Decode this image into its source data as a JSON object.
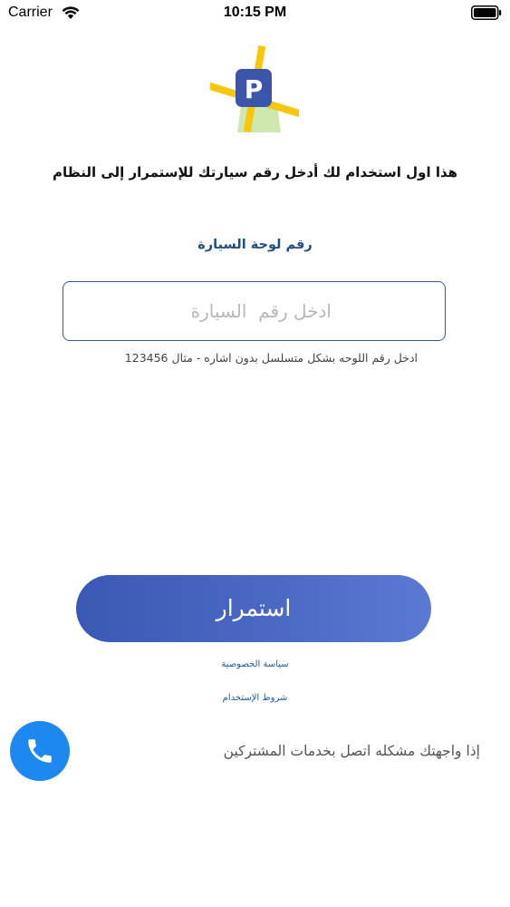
{
  "status_bar": {
    "carrier": "Carrier",
    "time": "10:15 PM"
  },
  "logo": {
    "letter": "P"
  },
  "headline": "هذا اول استخدام لك أدخل رقم سيارتك للإستمرار إلى النظام",
  "plate": {
    "label": "رقم لوحة السيارة",
    "placeholder": "ادخل رقم  السيارة",
    "hint": "ادخل رقم اللوحه بشكل متسلسل بدون اشاره -  مثال 123456"
  },
  "continue_label": "استمرار",
  "links": {
    "privacy": "سياسة الخصوصية",
    "terms": "شروط الإستخدام"
  },
  "support_text": "إذا واجهتك مشكله اتصل بخدمات المشتركين",
  "colors": {
    "accent": "#3a58b4",
    "call": "#1d89f0",
    "link": "#1f5b9e"
  }
}
